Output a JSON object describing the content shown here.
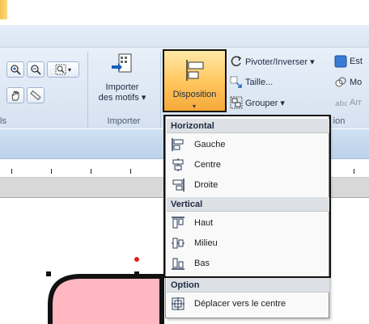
{
  "ribbon": {
    "view_group_label": "ls",
    "import_group": {
      "button_label_line1": "Importer",
      "button_label_line2": "des motifs ▾",
      "footer": "Importer"
    },
    "disposition_button": {
      "label": "Disposition",
      "arrow": "▾"
    },
    "arrange_group": {
      "items": [
        {
          "label": "Pivoter/Inverser ▾"
        },
        {
          "label": "Taille..."
        },
        {
          "label": "Grouper ▾"
        }
      ],
      "footer": "ion"
    },
    "right_group": {
      "items": [
        {
          "label": "Est"
        },
        {
          "label": "Mo"
        },
        {
          "label": "Arr"
        }
      ]
    }
  },
  "menu": {
    "sections": [
      {
        "header": "Horizontal",
        "items": [
          {
            "label": "Gauche",
            "icon": "align-left-icon"
          },
          {
            "label": "Centre",
            "icon": "align-center-icon"
          },
          {
            "label": "Droite",
            "icon": "align-right-icon"
          }
        ]
      },
      {
        "header": "Vertical",
        "items": [
          {
            "label": "Haut",
            "icon": "align-top-icon"
          },
          {
            "label": "Milieu",
            "icon": "align-middle-icon"
          },
          {
            "label": "Bas",
            "icon": "align-bottom-icon"
          }
        ]
      },
      {
        "header": "Option",
        "items": [
          {
            "label": "Déplacer vers le centre",
            "icon": "move-to-center-icon"
          }
        ]
      }
    ]
  },
  "colors": {
    "accent_orange": "#f6a93a",
    "ribbon_blue": "#dfe9f5",
    "shape_fill": "#ffb8c2",
    "selection_handle": "#111111",
    "rotate_handle": "#e02020"
  }
}
